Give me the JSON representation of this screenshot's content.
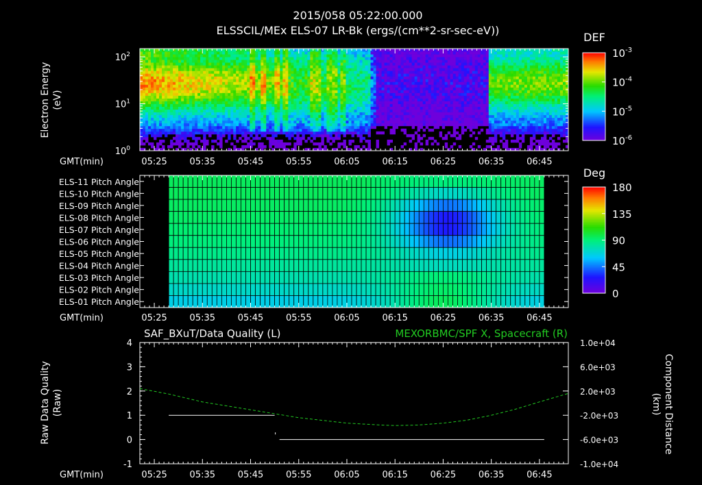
{
  "header": {
    "timestamp": "2015/058 05:22:00.000",
    "title": "ELSSCIL/MEx ELS-07 LR-Bk  (ergs/(cm**2-sr-sec-eV))"
  },
  "colors": {
    "background": "#000000",
    "axes": "#ffffff",
    "spf_x_line": "#22cc22",
    "quality_line": "#ffffff",
    "right_title_color": "#22cc22"
  },
  "time_axis": {
    "label": "GMT(min)",
    "ticks": [
      "05:25",
      "05:35",
      "05:45",
      "05:55",
      "06:05",
      "06:15",
      "06:25",
      "06:35",
      "06:45"
    ],
    "range_min": [
      322,
      411
    ]
  },
  "chart_data": [
    {
      "type": "heatmap",
      "name": "spectrogram",
      "ylabel_lines": [
        "Electron Energy",
        "(eV)"
      ],
      "y_scale": "log",
      "ylim": [
        1,
        150
      ],
      "y_ticks": [
        {
          "base": "10",
          "exp": "0",
          "value": 1
        },
        {
          "base": "10",
          "exp": "1",
          "value": 10
        },
        {
          "base": "10",
          "exp": "2",
          "value": 100
        }
      ],
      "colorbar": {
        "title": "DEF",
        "scale": "log",
        "range": [
          1e-06,
          0.001
        ],
        "ticks": [
          {
            "base": "10",
            "exp": "-3"
          },
          {
            "base": "10",
            "exp": "-4"
          },
          {
            "base": "10",
            "exp": "-5"
          },
          {
            "base": "10",
            "exp": "-6"
          }
        ]
      },
      "regions": [
        {
          "t_start": "05:22",
          "t_end": "05:52",
          "description": "peak near 30 eV, 10^-3.3 at start decaying to 10^-4"
        },
        {
          "t_start": "05:52",
          "t_end": "06:10",
          "description": "broadband 10^-4 to 10^-5 with vertical streaks"
        },
        {
          "t_start": "06:10",
          "t_end": "06:35",
          "description": "dropout near 10^-6"
        },
        {
          "t_start": "06:35",
          "t_end": "06:51",
          "description": "recovery, peak near 30 eV at 10^-4"
        }
      ]
    },
    {
      "type": "heatmap",
      "name": "pitch-angles",
      "rows": [
        "ELS-11 Pitch Angle",
        "ELS-10 Pitch Angle",
        "ELS-09 Pitch Angle",
        "ELS-08 Pitch Angle",
        "ELS-07 Pitch Angle",
        "ELS-06 Pitch Angle",
        "ELS-05 Pitch Angle",
        "ELS-04 Pitch Angle",
        "ELS-03 Pitch Angle",
        "ELS-02 Pitch Angle",
        "ELS-01 Pitch Angle"
      ],
      "data_range_time": [
        "05:28",
        "06:46"
      ],
      "colorbar": {
        "title": "Deg",
        "range": [
          0,
          180
        ],
        "ticks": [
          "180",
          "135",
          "90",
          "45",
          "0"
        ]
      },
      "typical_values_deg": {
        "ELS-11": 95,
        "ELS-10": 95,
        "ELS-09": 94,
        "ELS-08": 93,
        "ELS-07": 91,
        "ELS-06": 89,
        "ELS-05": 86,
        "ELS-04": 82,
        "ELS-03": 78,
        "ELS-02": 72,
        "ELS-01": 65
      },
      "min_region": {
        "rows": [
          "ELS-09",
          "ELS-08",
          "ELS-07",
          "ELS-06"
        ],
        "t_center": "06:26",
        "min_deg": 28
      },
      "high_region": {
        "rows": [
          "ELS-03",
          "ELS-02",
          "ELS-01"
        ],
        "t_center": "06:25",
        "max_deg": 95
      }
    },
    {
      "type": "line",
      "name": "quality-and-position",
      "title_left": "SAF_BXuT/Data Quality (L)",
      "title_right": "MEXORBMC/SPF X, Spacecraft (R)",
      "ylabel_left_lines": [
        "Raw Data Quality",
        "(Raw)"
      ],
      "ylabel_right_lines": [
        "Component Distance",
        "(km)"
      ],
      "ylim_left": [
        -1,
        4
      ],
      "y_ticks_left": [
        "-1",
        "0",
        "1",
        "2",
        "3",
        "4"
      ],
      "ylim_right": [
        -10000,
        10000
      ],
      "y_ticks_right": [
        "-1.0e+04",
        "-6.0e+03",
        "-2.0e+03",
        "2.0e+03",
        "6.0e+03",
        "1.0e+04"
      ],
      "series": [
        {
          "axis": "left",
          "style": "solid",
          "points": [
            [
              "05:28",
              1
            ],
            [
              "05:50",
              1
            ],
            [
              "05:51",
              0
            ],
            [
              "06:46",
              0
            ]
          ]
        },
        {
          "axis": "right",
          "style": "dashed",
          "points": [
            [
              "05:22",
              2400
            ],
            [
              "05:28",
              1500
            ],
            [
              "05:35",
              200
            ],
            [
              "05:45",
              -1100
            ],
            [
              "05:55",
              -2400
            ],
            [
              "06:05",
              -3300
            ],
            [
              "06:12",
              -3600
            ],
            [
              "06:15",
              -3700
            ],
            [
              "06:20",
              -3600
            ],
            [
              "06:25",
              -3300
            ],
            [
              "06:30",
              -2800
            ],
            [
              "06:35",
              -2000
            ],
            [
              "06:40",
              -1000
            ],
            [
              "06:45",
              200
            ],
            [
              "06:51",
              1600
            ]
          ]
        }
      ]
    }
  ]
}
